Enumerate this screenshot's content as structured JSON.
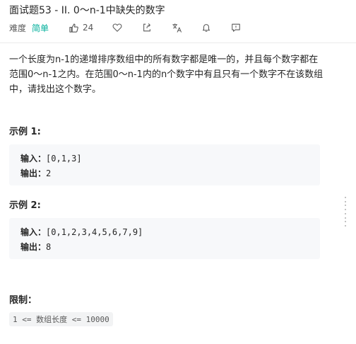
{
  "problem": {
    "title": "面试题53 - II. 0～n-1中缺失的数字",
    "difficulty_label": "难度",
    "difficulty": "简单",
    "likes": "24",
    "description": "一个长度为n-1的递增排序数组中的所有数字都是唯一的，并且每个数字都在范围0～n-1之内。在范围0～n-1内的n个数字中有且只有一个数字不在该数组中，请找出这个数字。"
  },
  "examples": [
    {
      "title": "示例 1:",
      "input_label": "输入：",
      "input": "[0,1,3]",
      "output_label": "输出：",
      "output": "2"
    },
    {
      "title": "示例 2:",
      "input_label": "输入：",
      "input": "[0,1,2,3,4,5,6,7,9]",
      "output_label": "输出：",
      "output": "8"
    }
  ],
  "constraints": {
    "title": "限制：",
    "items": [
      "1 <= 数组长度 <= 10000"
    ]
  },
  "colors": {
    "accent_easy": "#00af9b",
    "text": "#262626",
    "muted": "#595959",
    "code_bg": "#f7f8fa"
  },
  "icons": [
    "thumbs-up-icon",
    "heart-icon",
    "share-icon",
    "translate-icon",
    "bell-icon",
    "comment-icon"
  ]
}
